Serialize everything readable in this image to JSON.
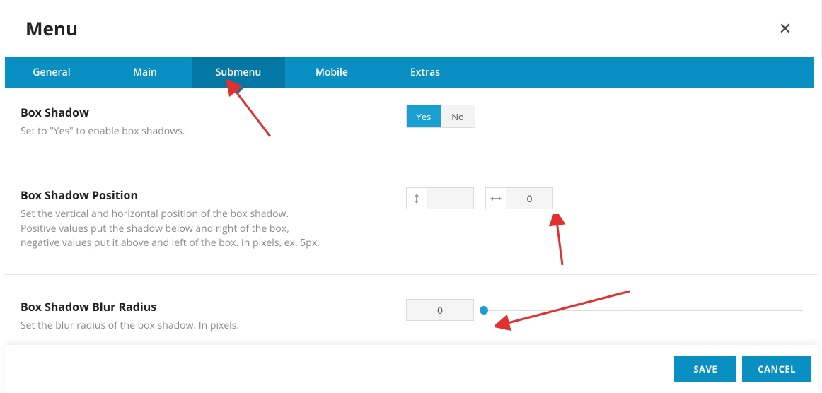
{
  "header": {
    "title": "Menu"
  },
  "tabs": {
    "items": [
      "General",
      "Main",
      "Submenu",
      "Mobile",
      "Extras"
    ],
    "active_index": 2
  },
  "sections": {
    "box_shadow": {
      "title": "Box Shadow",
      "desc": "Set to \"Yes\" to enable box shadows.",
      "toggle": {
        "yes": "Yes",
        "no": "No",
        "value": "Yes"
      }
    },
    "box_shadow_position": {
      "title": "Box Shadow Position",
      "desc": "Set the vertical and horizontal position of the box shadow. Positive values put the shadow below and right of the box, negative values put it above and left of the box. In pixels, ex. 5px.",
      "v_value": "",
      "h_value": "0"
    },
    "box_shadow_blur": {
      "title": "Box Shadow Blur Radius",
      "desc": "Set the blur radius of the box shadow. In pixels.",
      "value": "0"
    }
  },
  "footer": {
    "save": "SAVE",
    "cancel": "CANCEL"
  }
}
